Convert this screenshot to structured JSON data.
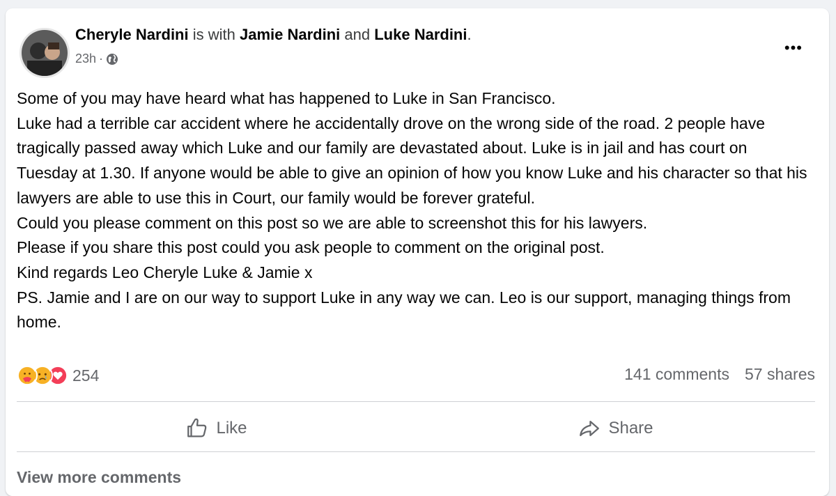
{
  "post": {
    "author": "Cheryle Nardini",
    "with_text": "is with",
    "tagged1": "Jamie Nardini",
    "and_text": "and",
    "tagged2": "Luke Nardini",
    "period": ".",
    "timestamp": "23h",
    "separator": "·",
    "audience_icon": "globe-icon",
    "more_label": "•••",
    "lines": [
      "Some of you may have heard what has happened to Luke in San Francisco.",
      "Luke had a terrible car accident where he accidentally drove on the wrong side of the road. 2 people have tragically passed away which Luke and our family are devastated about. Luke is in jail and has court on Tuesday at 1.30. If anyone would be able to give an opinion of how you know Luke and his character so that his lawyers are able to use this in Court, our family would be forever grateful.",
      "Could you please comment on this post so we are able to screenshot this for his lawyers.",
      "Please if you share this post could you ask people to comment on the original post.",
      "Kind regards Leo Cheryle Luke & Jamie x",
      "PS. Jamie and I are on our way to support Luke in any way we can. Leo is our support, managing things from home."
    ]
  },
  "stats": {
    "reactions": [
      "care",
      "sad",
      "love"
    ],
    "reaction_count": "254",
    "comments": "141 comments",
    "shares": "57 shares"
  },
  "actions": {
    "like": "Like",
    "share": "Share"
  },
  "footer": {
    "view_more": "View more comments"
  },
  "colors": {
    "care": "#f7b125",
    "sad": "#f7b125",
    "love": "#f33e58",
    "secondary_text": "#65676b"
  }
}
